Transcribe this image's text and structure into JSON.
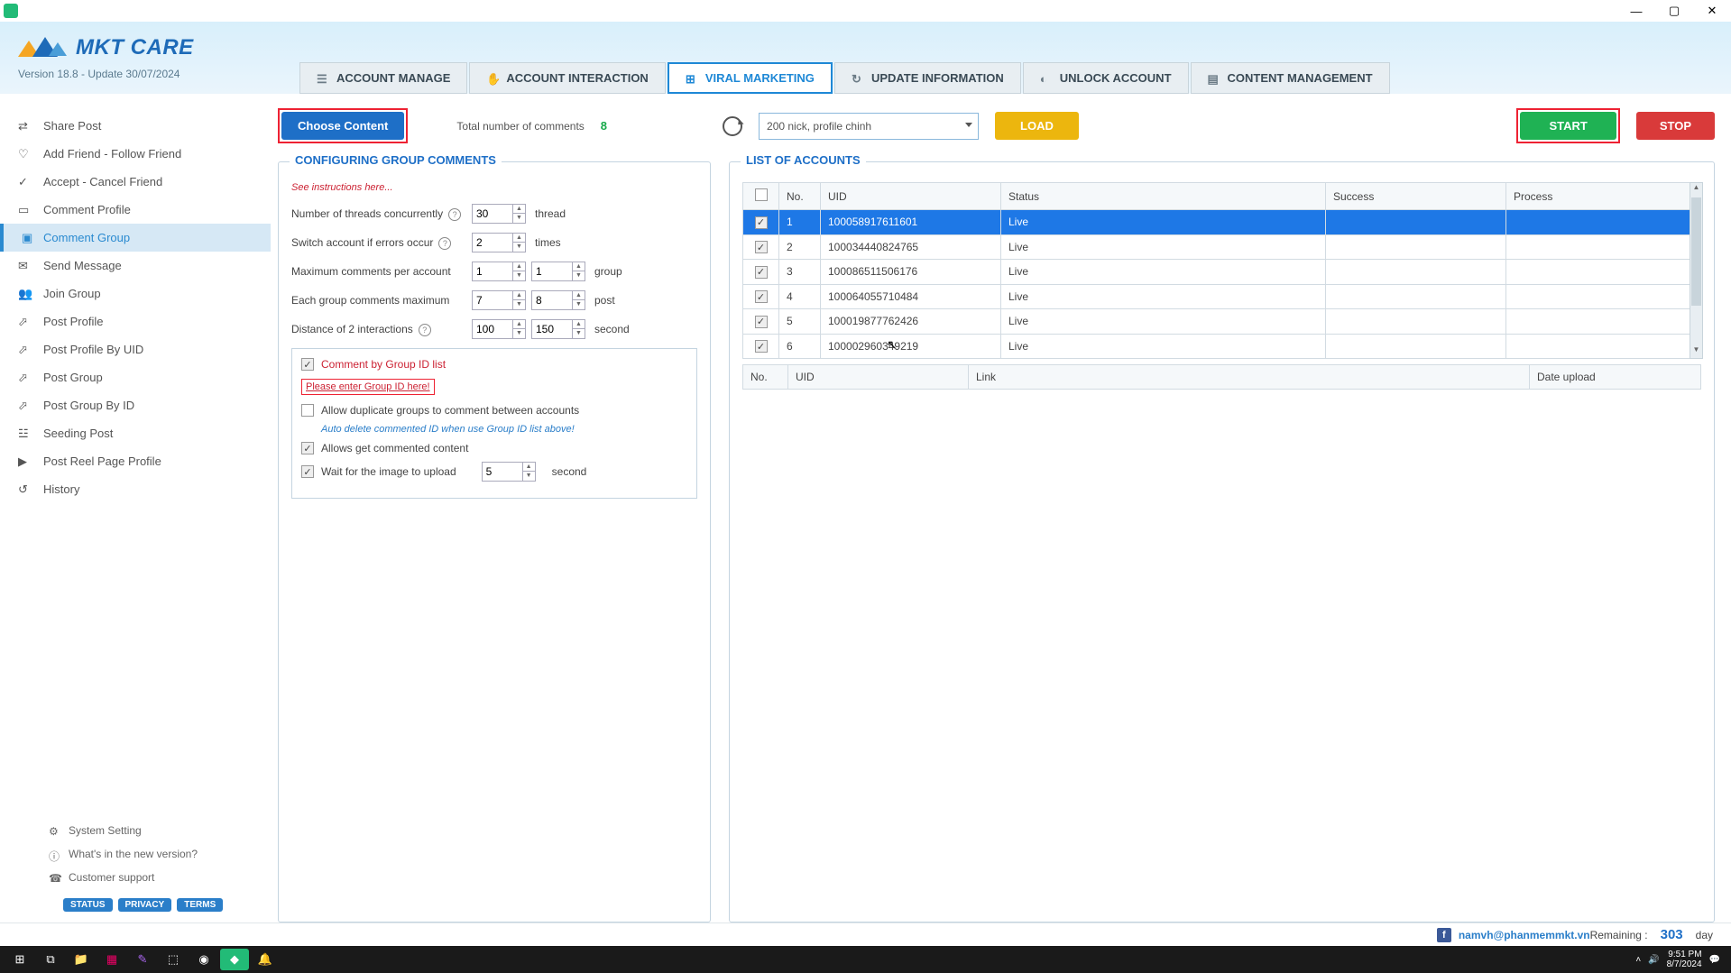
{
  "app": {
    "name": "MKT CARE",
    "version_line": "Version  18.8  -  Update  30/07/2024"
  },
  "win": {
    "min": "—",
    "max": "▢",
    "close": "✕"
  },
  "tabs": {
    "account_manage": "ACCOUNT MANAGE",
    "account_interaction": "ACCOUNT INTERACTION",
    "viral_marketing": "VIRAL MARKETING",
    "update_information": "UPDATE INFORMATION",
    "unlock_account": "UNLOCK ACCOUNT",
    "content_management": "CONTENT MANAGEMENT"
  },
  "sidebar": {
    "items": {
      "share_post": "Share Post",
      "add_friend": "Add Friend - Follow Friend",
      "accept_cancel": "Accept - Cancel Friend",
      "comment_profile": "Comment Profile",
      "comment_group": "Comment Group",
      "send_message": "Send Message",
      "join_group": "Join Group",
      "post_profile": "Post Profile",
      "post_profile_uid": "Post Profile By UID",
      "post_group": "Post Group",
      "post_group_id": "Post Group By ID",
      "seeding_post": "Seeding Post",
      "post_reel": "Post Reel Page Profile",
      "history": "History"
    },
    "footer": {
      "system_setting": "System Setting",
      "whats_new": "What's in the new version?",
      "customer_support": "Customer support",
      "status": "STATUS",
      "privacy": "PRIVACY",
      "terms": "TERMS"
    }
  },
  "toolbar": {
    "choose_content": "Choose Content",
    "total_label": "Total number of comments",
    "total_value": "8",
    "combo_value": "200 nick, profile chinh",
    "load": "LOAD",
    "start": "START",
    "stop": "STOP"
  },
  "config": {
    "panel_title": "CONFIGURING GROUP COMMENTS",
    "instructions": "See instructions here...",
    "threads_lbl": "Number of threads concurrently",
    "threads_val": "30",
    "threads_unit": "thread",
    "switch_lbl": "Switch account if errors occur",
    "switch_val": "2",
    "switch_unit": "times",
    "maxacct_lbl": "Maximum comments per account",
    "maxacct_a": "1",
    "maxacct_b": "1",
    "maxacct_unit": "group",
    "eachgrp_lbl": "Each group comments maximum",
    "eachgrp_a": "7",
    "eachgrp_b": "8",
    "eachgrp_unit": "post",
    "dist_lbl": "Distance of 2 interactions",
    "dist_a": "100",
    "dist_b": "150",
    "dist_unit": "second",
    "chk_byid": "Comment by Group ID list",
    "link_enter": "Please enter Group ID here!",
    "chk_dup": "Allow duplicate groups to comment between accounts",
    "hint_auto": "Auto delete commented ID when use Group ID list above!",
    "chk_getcontent": "Allows get commented content",
    "chk_wait": "Wait for the image to upload",
    "wait_val": "5",
    "wait_unit": "second"
  },
  "accounts": {
    "panel_title": "LIST OF ACCOUNTS",
    "headers": {
      "no": "No.",
      "uid": "UID",
      "status": "Status",
      "success": "Success",
      "process": "Process"
    },
    "rows": [
      {
        "no": "1",
        "uid": "100058917611601",
        "status": "Live",
        "success": "",
        "process": "",
        "selected": true
      },
      {
        "no": "2",
        "uid": "100034440824765",
        "status": "Live",
        "success": "",
        "process": "",
        "selected": false
      },
      {
        "no": "3",
        "uid": "100086511506176",
        "status": "Live",
        "success": "",
        "process": "",
        "selected": false
      },
      {
        "no": "4",
        "uid": "100064055710484",
        "status": "Live",
        "success": "",
        "process": "",
        "selected": false
      },
      {
        "no": "5",
        "uid": "100019877762426",
        "status": "Live",
        "success": "",
        "process": "",
        "selected": false
      },
      {
        "no": "6",
        "uid": "100002960349219",
        "status": "Live",
        "success": "",
        "process": "",
        "selected": false
      }
    ],
    "sub_headers": {
      "no": "No.",
      "uid": "UID",
      "link": "Link",
      "date": "Date upload"
    }
  },
  "footer": {
    "email": "namvh@phanmemmkt.vn",
    "remaining_lbl": "Remaining :",
    "remaining_val": "303",
    "remaining_unit": "day"
  },
  "taskbar": {
    "time": "9:51 PM",
    "date": "8/7/2024"
  }
}
